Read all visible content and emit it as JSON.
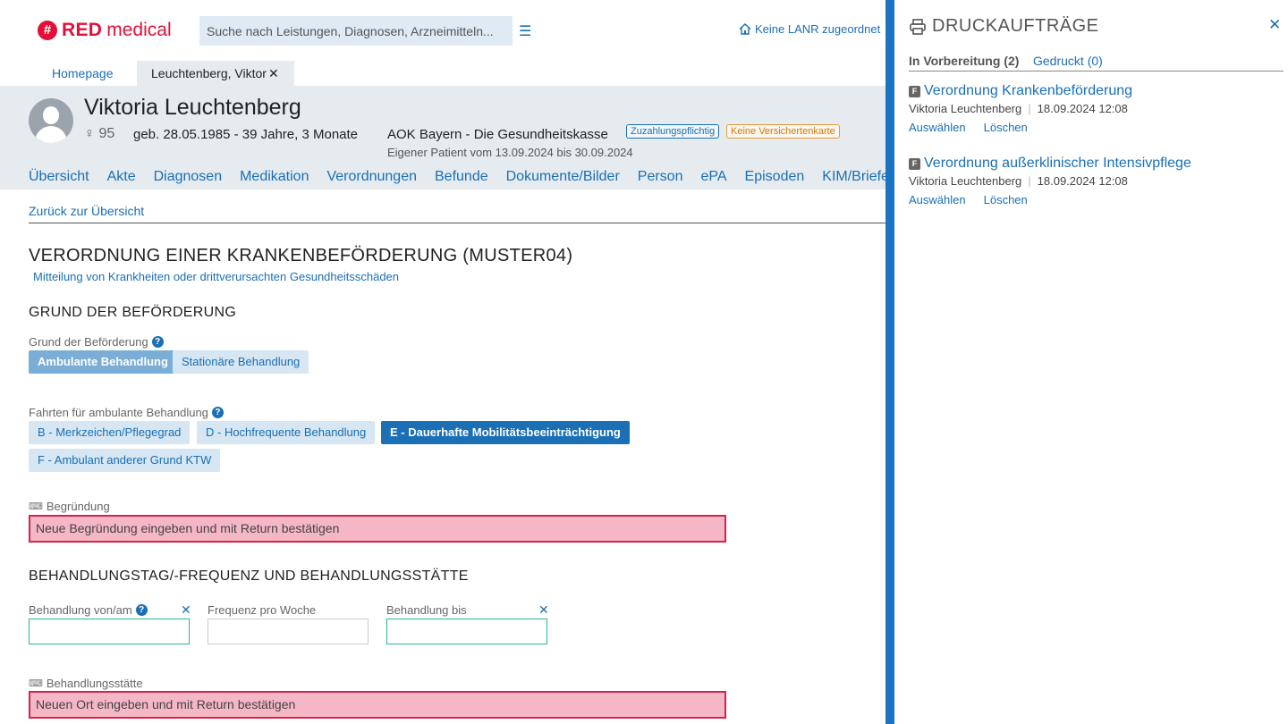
{
  "app": {
    "logo_mark": "#",
    "logo_red": "RED",
    "logo_medical": "medical",
    "search_placeholder": "Suche nach Leistungen, Diagnosen, Arzneimitteln...",
    "lanr": "Keine LANR zugeordnet"
  },
  "tabs": {
    "home": "Homepage",
    "patient": "Leuchtenberg, Viktor",
    "close": "✕"
  },
  "patient": {
    "name": "Viktoria Leuchtenberg",
    "gender_age": "♀ 95",
    "birth": "geb. 28.05.1985 - 39 Jahre, 3 Monate",
    "insurance": "AOK Bayern - Die Gesundheitskasse",
    "badge_copay": "Zuzahlungspflichtig",
    "badge_card": "Keine Versichertenkarte",
    "own_patient": "Eigener Patient vom 13.09.2024 bis 30.09.2024",
    "nav": [
      "Übersicht",
      "Akte",
      "Diagnosen",
      "Medikation",
      "Verordnungen",
      "Befunde",
      "Dokumente/Bilder",
      "Person",
      "ePA",
      "Episoden",
      "KIM/Briefe"
    ]
  },
  "form": {
    "back": "Zurück zur Übersicht",
    "title": "VERORDNUNG EINER KRANKENBEFÖRDERUNG (MUSTER04)",
    "subtitle": "Mitteilung von Krankheiten oder drittverursachten Gesundheitsschäden",
    "section1": "GRUND DER BEFÖRDERUNG",
    "reason_label": "Grund der Beförderung",
    "reason_options": [
      "Ambulante Behandlung",
      "Stationäre Behandlung"
    ],
    "trips_label": "Fahrten für ambulante Behandlung",
    "trip_options": [
      "B - Merkzeichen/Pflegegrad",
      "D - Hochfrequente Behandlung",
      "E - Dauerhafte Mobilitätsbeeinträchtigung",
      "F - Ambulant anderer Grund KTW"
    ],
    "justification_label": "Begründung",
    "justification_placeholder": "Neue Begründung eingeben und mit Return bestätigen",
    "section2": "BEHANDLUNGSTAG/-FREQUENZ UND BEHANDLUNGSSTÄTTE",
    "from_label": "Behandlung von/am",
    "freq_label": "Frequenz pro Woche",
    "until_label": "Behandlung bis",
    "place_label": "Behandlungsstätte",
    "place_placeholder": "Neuen Ort eingeben und mit Return bestätigen"
  },
  "print_panel": {
    "title": "DRUCKAUFTRÄGE",
    "tab_prep": "In Vorbereitung (2)",
    "tab_printed": "Gedruckt (0)",
    "jobs": [
      {
        "badge": "F",
        "title": "Verordnung Krankenbeförderung",
        "patient": "Viktoria Leuchtenberg",
        "date": "18.09.2024 12:08",
        "select": "Auswählen",
        "delete": "Löschen"
      },
      {
        "badge": "F",
        "title": "Verordnung außerklinischer Intensivpflege",
        "patient": "Viktoria Leuchtenberg",
        "date": "18.09.2024 12:08",
        "select": "Auswählen",
        "delete": "Löschen"
      }
    ]
  },
  "colors": {
    "brand_red": "#e30f38",
    "link_blue": "#1a6fb5",
    "separator_blue": "#1a74c2",
    "error_pink": "#f5b6c6",
    "focus_green": "#26b99a"
  }
}
